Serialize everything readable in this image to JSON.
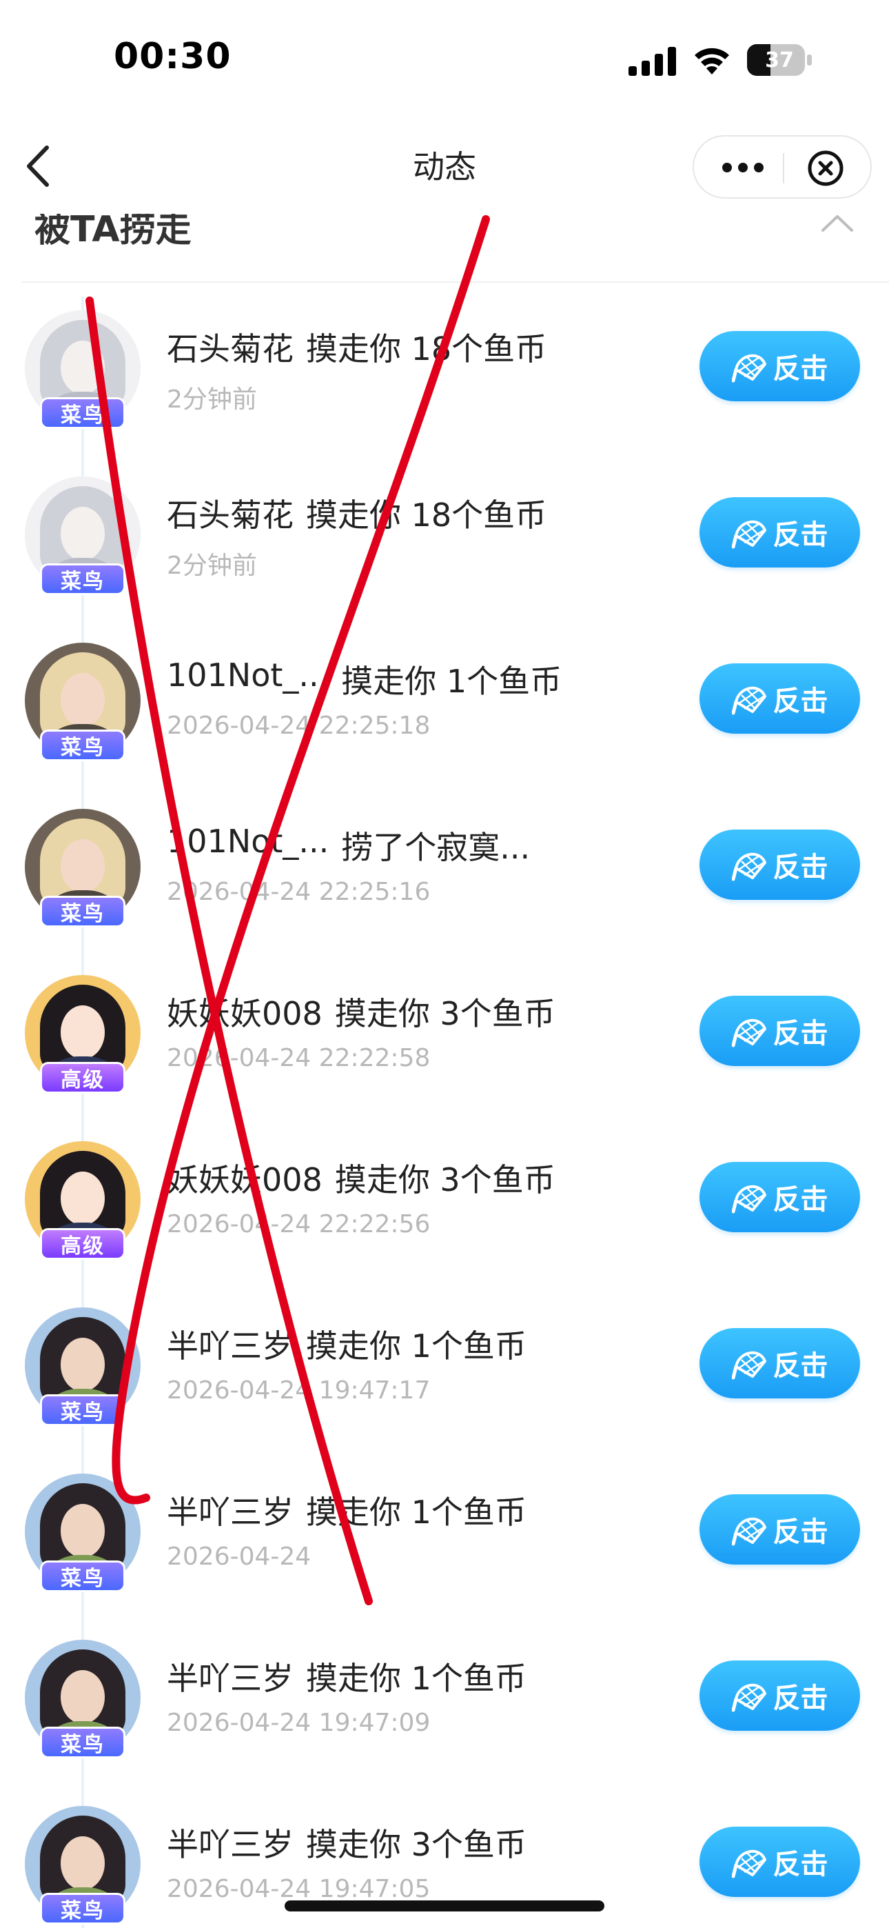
{
  "status_bar": {
    "time": "00:30",
    "battery": "37"
  },
  "nav": {
    "title": "动态"
  },
  "section": {
    "title": "被TA捞走"
  },
  "items": [
    {
      "name": "石头菊花",
      "action": "摸走你 18个鱼币",
      "time": "2分钟前",
      "badge": "菜鸟",
      "button": "反击"
    },
    {
      "name": "石头菊花",
      "action": "摸走你 18个鱼币",
      "time": "2分钟前",
      "badge": "菜鸟",
      "button": "反击"
    },
    {
      "name": "101Not_...",
      "action": "摸走你 1个鱼币",
      "time": "2026-04-24 22:25:18",
      "badge": "菜鸟",
      "button": "反击"
    },
    {
      "name": "101Not_...",
      "action": "捞了个寂寞...",
      "time": "2026-04-24 22:25:16",
      "badge": "菜鸟",
      "button": "反击"
    },
    {
      "name": "妖妖妖008",
      "action": "摸走你 3个鱼币",
      "time": "2026-04-24 22:22:58",
      "badge": "高级",
      "button": "反击"
    },
    {
      "name": "妖妖妖008",
      "action": "摸走你 3个鱼币",
      "time": "2026-04-24 22:22:56",
      "badge": "高级",
      "button": "反击"
    },
    {
      "name": "半吖三岁",
      "action": "摸走你 1个鱼币",
      "time": "2026-04-24 19:47:17",
      "badge": "菜鸟",
      "button": "反击"
    },
    {
      "name": "半吖三岁",
      "action": "摸走你 1个鱼币",
      "time": "2026-04-24",
      "badge": "菜鸟",
      "button": "反击"
    },
    {
      "name": "半吖三岁",
      "action": "摸走你 1个鱼币",
      "time": "2026-04-24 19:47:09",
      "badge": "菜鸟",
      "button": "反击"
    },
    {
      "name": "半吖三岁",
      "action": "摸走你 3个鱼币",
      "time": "2026-04-24 19:47:05",
      "badge": "菜鸟",
      "button": "反击"
    }
  ],
  "colors": {
    "button_blue": "#1a9df5",
    "badge_rookie": "#4a68ff",
    "badge_senior": "#7a3bff",
    "annotation_red": "#e0001b",
    "time_gray": "#b8b8b8"
  },
  "icons": [
    "back-icon",
    "more-icon",
    "close-icon",
    "collapse-icon",
    "net-icon",
    "signal-icon",
    "wifi-icon",
    "battery-icon"
  ]
}
